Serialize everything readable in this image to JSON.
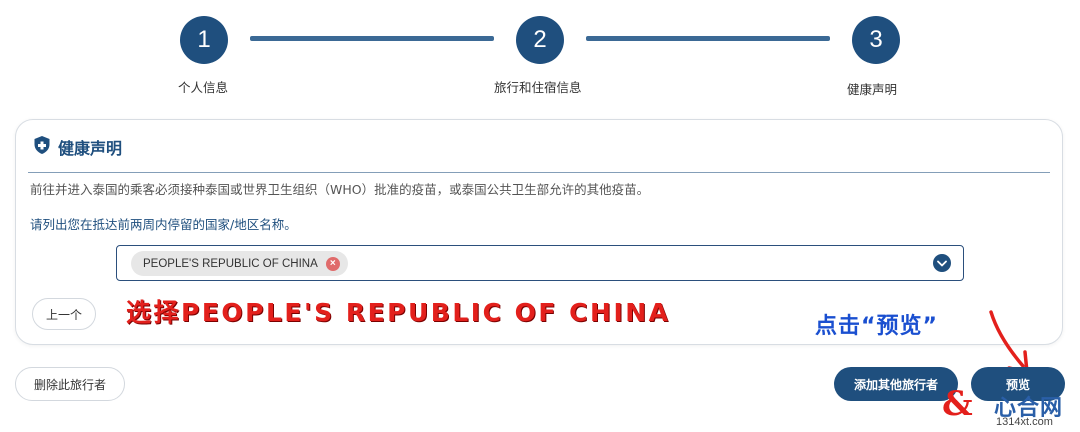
{
  "stepper": {
    "steps": [
      {
        "number": "1",
        "label": "个人信息"
      },
      {
        "number": "2",
        "label": "旅行和住宿信息"
      },
      {
        "number": "3",
        "label": "健康声明"
      }
    ]
  },
  "card": {
    "title": "健康声明",
    "title_icon": "shield-icon",
    "note": "前往并进入泰国的乘客必须接种泰国或世界卫生组织（WHO）批准的疫苗，或泰国公共卫生部允许的其他疫苗。",
    "question": "请列出您在抵达前两周内停留的国家/地区名称。",
    "country_select": {
      "selected": [
        "PEOPLE'S REPUBLIC OF CHINA"
      ],
      "remove_icon": "close-icon",
      "toggle_icon": "chevron-down-icon"
    },
    "prev_label": "上一个"
  },
  "annotations": {
    "red_text": "选择PEOPLE'S REPUBLIC OF CHINA",
    "blue_text": "点击“预览”",
    "red_color": "#e3201c",
    "blue_color": "#1a4fd0"
  },
  "footer": {
    "delete_label": "删除此旅行者",
    "add_label": "添加其他旅行者",
    "preview_label": "预览"
  },
  "watermark": {
    "symbol": "&",
    "name": "心合网",
    "url": "1314xt.com"
  },
  "colors": {
    "primary": "#1f4f7e",
    "chip_remove": "#e06b6b"
  }
}
